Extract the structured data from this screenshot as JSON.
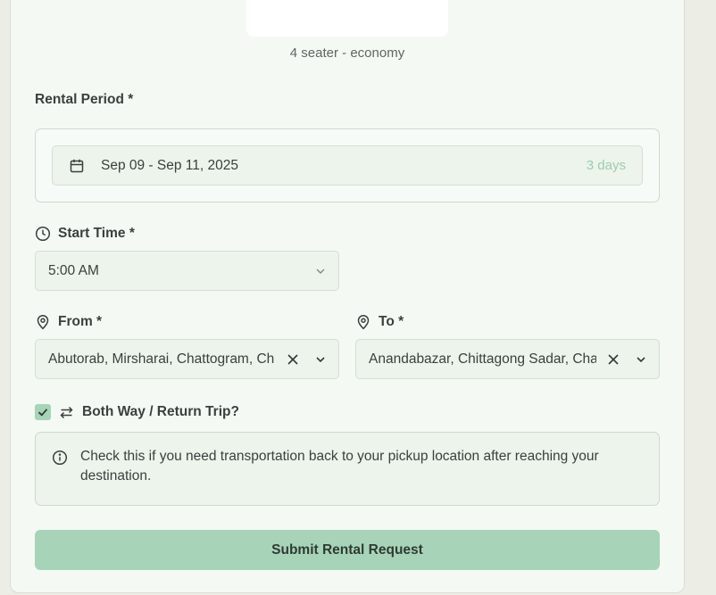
{
  "car": {
    "caption": "4 seater - economy"
  },
  "rental_period": {
    "label": "Rental Period *",
    "date_range": "Sep 09 - Sep 11, 2025",
    "duration": "3 days"
  },
  "start_time": {
    "label": "Start Time *",
    "value": "5:00 AM"
  },
  "from": {
    "label": "From *",
    "value": "Abutorab, Mirsharai, Chattogram, Ch"
  },
  "to": {
    "label": "To *",
    "value": "Anandabazar, Chittagong Sadar, Cha"
  },
  "return_trip": {
    "label": "Both Way / Return Trip?",
    "checked": true,
    "info": "Check this if you need transportation back to your pickup location after reaching your destination."
  },
  "submit": {
    "label": "Submit Rental Request"
  },
  "colors": {
    "accent": "#a7d4b8",
    "background": "#f4f9f4",
    "field": "#ecf4ec",
    "muted_accent_text": "#9fcbb0"
  },
  "icons": {
    "calendar": "calendar-icon",
    "clock": "clock-icon",
    "pin": "map-pin-icon",
    "swap": "swap-arrows-icon",
    "info": "info-icon",
    "clear": "close-icon",
    "chevron": "chevron-down-icon",
    "check": "check-icon"
  }
}
